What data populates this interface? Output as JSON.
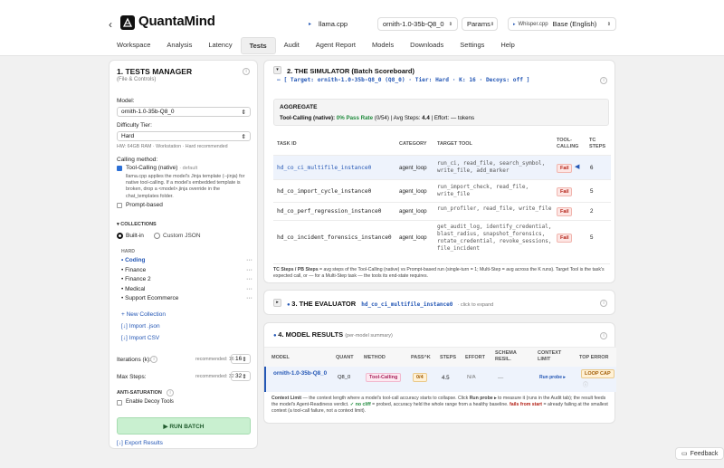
{
  "header": {
    "app_title": "QuantaMind",
    "backend": "llama.cpp",
    "model": "ornith-1.0-35b-Q8_0",
    "params": "Params",
    "whisper_label": "Whisper.cpp",
    "whisper_model": "Base (English)"
  },
  "tabs": [
    "Workspace",
    "Analysis",
    "Latency",
    "Tests",
    "Audit",
    "Agent Report",
    "Models",
    "Downloads",
    "Settings",
    "Help"
  ],
  "manager": {
    "title": "1. TESTS MANAGER",
    "subtitle": "(File & Controls)",
    "model_label": "Model:",
    "model_value": "ornith-1.0-35b-Q8_0",
    "tier_label": "Difficulty Tier:",
    "tier_value": "Hard",
    "hw_note": "HW: 64GB RAM · Workstation · Hard recommended",
    "calling_label": "Calling method:",
    "tool_calling": "Tool-Calling (native)",
    "tool_default": "· default",
    "tool_desc": "llama.cpp applies the model's Jinja template (--jinja) for native tool-calling. If a model's embedded template is broken, drop a <model>.jinja override in the chat_templates folder.",
    "prompt_based": "Prompt-based",
    "collections_title": "COLLECTIONS",
    "builtin": "Built-in",
    "custom_json": "Custom JSON",
    "hard_label": "HARD",
    "collections": [
      "Coding",
      "Finance",
      "Finance 2",
      "Medical",
      "Support Ecommerce"
    ],
    "new_collection": "+ New Collection",
    "import_json": "[↓] Import .json",
    "import_csv": "[↓] Import CSV",
    "iterations_label": "Iterations (k):",
    "iterations_rec": "recommended: 16",
    "iterations_value": "16",
    "maxsteps_label": "Max Steps:",
    "maxsteps_rec": "recommended: 32",
    "maxsteps_value": "32",
    "anti_title": "ANTI-SATURATION",
    "decoy_label": "Enable Decoy Tools",
    "run_batch": "▶ RUN BATCH",
    "export": "[↓] Export Results"
  },
  "simulator": {
    "title": "2. THE SIMULATOR (Batch Scoreboard)",
    "target_line": "– [ Target: ornith-1.0-35b-Q8_0 (Q8_0) · Tier: Hard · K: 16 · Decoys: off ]",
    "agg_title": "AGGREGATE",
    "agg_line_pre": "Tool-Calling (native): ",
    "agg_rate": "0% Pass Rate",
    "agg_line_post": " (0/54) | Avg Steps: ",
    "agg_steps": "4.4",
    "agg_effort": " | Effort: — tokens",
    "headers": [
      "TASK ID",
      "CATEGORY",
      "TARGET TOOL",
      "TOOL-CALLING",
      "TC STEPS"
    ],
    "rows": [
      {
        "id": "hd_co_ci_multifile_instance0",
        "cat": "agent_loop",
        "tools": "run_ci, read_file, search_symbol, write_file, add_marker",
        "result": "Fail",
        "steps": "6"
      },
      {
        "id": "hd_co_import_cycle_instance0",
        "cat": "agent_loop",
        "tools": "run_import_check, read_file, write_file",
        "result": "Fail",
        "steps": "5"
      },
      {
        "id": "hd_co_perf_regression_instance0",
        "cat": "agent_loop",
        "tools": "run_profiler, read_file, write_file",
        "result": "Fail",
        "steps": "2"
      },
      {
        "id": "hd_co_incident_forensics_instance0",
        "cat": "agent_loop",
        "tools": "get_audit_log, identify_credential, blast_radius, snapshot_forensics, rotate_credential, revoke_sessions, file_incident",
        "result": "Fail",
        "steps": "5"
      }
    ],
    "footnote_bold": "TC Steps / PB Steps",
    "footnote": " = avg steps of the Tool-Calling (native) vs Prompt-based run (single-turn = 1; Multi-Step = avg across the K runs). Target Tool is the task's expected call, or — for a Multi-Step task — the tools its end-state requires."
  },
  "evaluator": {
    "title": "3. THE EVALUATOR",
    "task": "hd_co_ci_multifile_instance0",
    "hint": "· click to expand"
  },
  "results": {
    "title": "4. MODEL RESULTS",
    "sub": "(per-model summary)",
    "headers": [
      "MODEL",
      "QUANT",
      "METHOD",
      "PASS^K",
      "STEPS",
      "EFFORT",
      "SCHEMA RESIL.",
      "CONTEXT LIMIT",
      "TOP ERROR"
    ],
    "model": "ornith-1.0-35b-Q8_0",
    "quant": "Q8_0",
    "method": "Tool-Calling",
    "pass": "0/4",
    "steps": "4.5",
    "effort": "N/A",
    "schema": "—",
    "context": "Run probe ▸",
    "error": "LOOP CAP",
    "note_bold": "Context Limit",
    "note_a": " — the context length where a model's tool-call accuracy starts to collapse. Click ",
    "note_run": "Run probe ▸",
    "note_b": " to measure it (runs in the Audit tab); the result feeds the model's Agent-Readiness verdict. ",
    "note_nocliff": "✓ no cliff",
    "note_c": " = probed, accuracy held the whole range from a healthy baseline. ",
    "note_fails": "fails from start",
    "note_d": " = already failing at the smallest context (a tool-call failure, not a context limit)."
  },
  "feedback": "Feedback",
  "colors": {
    "accent": "#2457b5",
    "run_green": "#c9f0d0",
    "fail_red": "#b42318",
    "amber": "#a05a00"
  }
}
